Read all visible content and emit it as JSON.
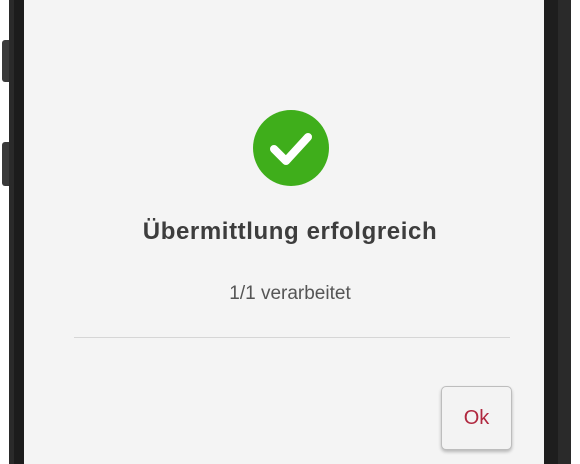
{
  "dialog": {
    "title": "Übermittlung erfolgreich",
    "status": "1/1 verarbeitet",
    "ok_label": "Ok",
    "icon": "check-circle-icon"
  },
  "colors": {
    "success_green": "#3fae1b",
    "ok_text": "#b0283f",
    "screen_bg": "#f4f4f4",
    "phone_frame": "#2a2a2a"
  }
}
